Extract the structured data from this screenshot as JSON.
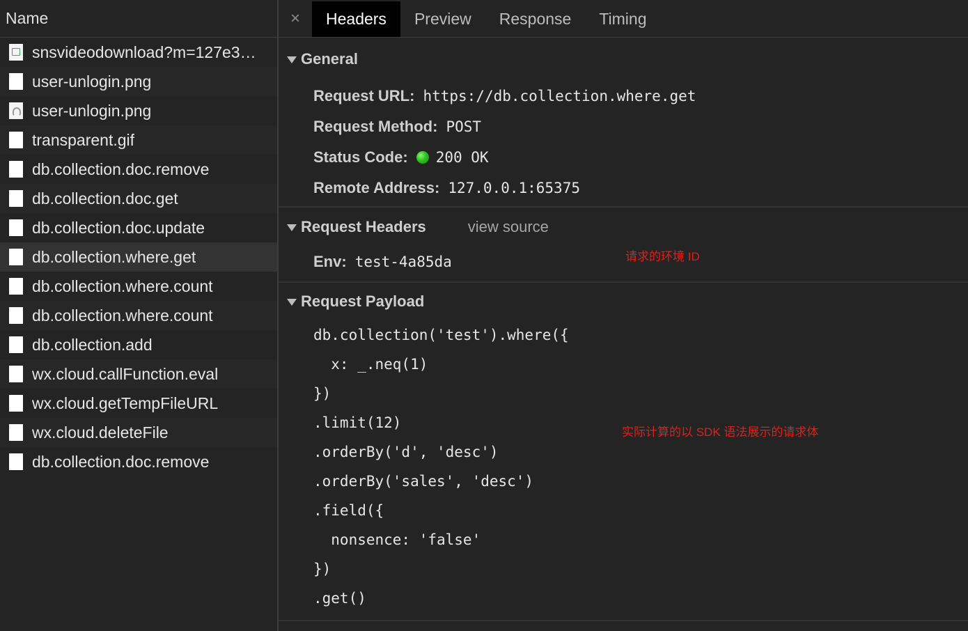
{
  "left_panel": {
    "header": "Name",
    "requests": [
      {
        "name": "snsvideodownload?m=127e3…",
        "icon": "image-icon"
      },
      {
        "name": "user-unlogin.png",
        "icon": "file-icon"
      },
      {
        "name": "user-unlogin.png",
        "icon": "avatar-icon"
      },
      {
        "name": "transparent.gif",
        "icon": "file-icon"
      },
      {
        "name": "db.collection.doc.remove",
        "icon": "file-icon"
      },
      {
        "name": "db.collection.doc.get",
        "icon": "file-icon"
      },
      {
        "name": "db.collection.doc.update",
        "icon": "file-icon"
      },
      {
        "name": "db.collection.where.get",
        "icon": "file-icon",
        "selected": true
      },
      {
        "name": "db.collection.where.count",
        "icon": "file-icon"
      },
      {
        "name": "db.collection.where.count",
        "icon": "file-icon"
      },
      {
        "name": "db.collection.add",
        "icon": "file-icon"
      },
      {
        "name": "wx.cloud.callFunction.eval",
        "icon": "file-icon"
      },
      {
        "name": "wx.cloud.getTempFileURL",
        "icon": "file-icon"
      },
      {
        "name": "wx.cloud.deleteFile",
        "icon": "file-icon"
      },
      {
        "name": "db.collection.doc.remove",
        "icon": "file-icon"
      }
    ]
  },
  "tabs": {
    "close_symbol": "×",
    "items": [
      "Headers",
      "Preview",
      "Response",
      "Timing"
    ],
    "active": "Headers"
  },
  "general": {
    "title": "General",
    "request_url_label": "Request URL:",
    "request_url": "https://db.collection.where.get",
    "request_method_label": "Request Method:",
    "request_method": "POST",
    "status_code_label": "Status Code:",
    "status_code": "200 OK",
    "status_color": "#2dc21e",
    "remote_address_label": "Remote Address:",
    "remote_address": "127.0.0.1:65375"
  },
  "request_headers": {
    "title": "Request Headers",
    "view_source": "view source",
    "env_label": "Env:",
    "env_value": "test-4a85da",
    "annotation": "请求的环境 ID"
  },
  "request_payload": {
    "title": "Request Payload",
    "annotation": "实际计算的以 SDK 语法展示的请求体",
    "code_lines": [
      "db.collection('test').where({",
      "  x: _.neq(1)",
      "})",
      ".limit(12)",
      ".orderBy('d', 'desc')",
      ".orderBy('sales', 'desc')",
      ".field({",
      "  nonsence: 'false'",
      "})",
      ".get()"
    ]
  },
  "colors": {
    "background": "#242424",
    "active_tab": "#000000",
    "annotation": "#e0201b"
  }
}
